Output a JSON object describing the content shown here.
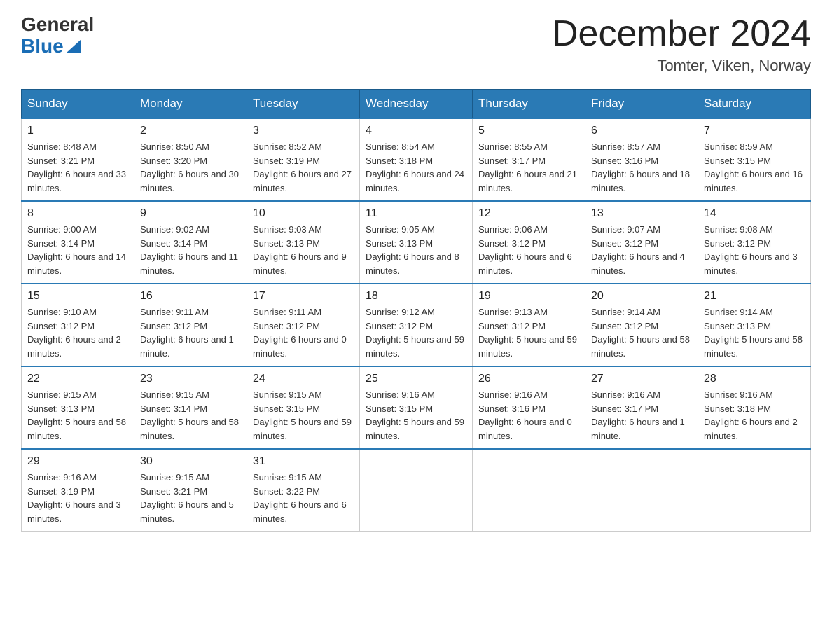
{
  "header": {
    "logo_general": "General",
    "logo_blue": "Blue",
    "month_title": "December 2024",
    "location": "Tomter, Viken, Norway"
  },
  "days_of_week": [
    "Sunday",
    "Monday",
    "Tuesday",
    "Wednesday",
    "Thursday",
    "Friday",
    "Saturday"
  ],
  "weeks": [
    [
      {
        "day": "1",
        "sunrise": "8:48 AM",
        "sunset": "3:21 PM",
        "daylight": "6 hours and 33 minutes."
      },
      {
        "day": "2",
        "sunrise": "8:50 AM",
        "sunset": "3:20 PM",
        "daylight": "6 hours and 30 minutes."
      },
      {
        "day": "3",
        "sunrise": "8:52 AM",
        "sunset": "3:19 PM",
        "daylight": "6 hours and 27 minutes."
      },
      {
        "day": "4",
        "sunrise": "8:54 AM",
        "sunset": "3:18 PM",
        "daylight": "6 hours and 24 minutes."
      },
      {
        "day": "5",
        "sunrise": "8:55 AM",
        "sunset": "3:17 PM",
        "daylight": "6 hours and 21 minutes."
      },
      {
        "day": "6",
        "sunrise": "8:57 AM",
        "sunset": "3:16 PM",
        "daylight": "6 hours and 18 minutes."
      },
      {
        "day": "7",
        "sunrise": "8:59 AM",
        "sunset": "3:15 PM",
        "daylight": "6 hours and 16 minutes."
      }
    ],
    [
      {
        "day": "8",
        "sunrise": "9:00 AM",
        "sunset": "3:14 PM",
        "daylight": "6 hours and 14 minutes."
      },
      {
        "day": "9",
        "sunrise": "9:02 AM",
        "sunset": "3:14 PM",
        "daylight": "6 hours and 11 minutes."
      },
      {
        "day": "10",
        "sunrise": "9:03 AM",
        "sunset": "3:13 PM",
        "daylight": "6 hours and 9 minutes."
      },
      {
        "day": "11",
        "sunrise": "9:05 AM",
        "sunset": "3:13 PM",
        "daylight": "6 hours and 8 minutes."
      },
      {
        "day": "12",
        "sunrise": "9:06 AM",
        "sunset": "3:12 PM",
        "daylight": "6 hours and 6 minutes."
      },
      {
        "day": "13",
        "sunrise": "9:07 AM",
        "sunset": "3:12 PM",
        "daylight": "6 hours and 4 minutes."
      },
      {
        "day": "14",
        "sunrise": "9:08 AM",
        "sunset": "3:12 PM",
        "daylight": "6 hours and 3 minutes."
      }
    ],
    [
      {
        "day": "15",
        "sunrise": "9:10 AM",
        "sunset": "3:12 PM",
        "daylight": "6 hours and 2 minutes."
      },
      {
        "day": "16",
        "sunrise": "9:11 AM",
        "sunset": "3:12 PM",
        "daylight": "6 hours and 1 minute."
      },
      {
        "day": "17",
        "sunrise": "9:11 AM",
        "sunset": "3:12 PM",
        "daylight": "6 hours and 0 minutes."
      },
      {
        "day": "18",
        "sunrise": "9:12 AM",
        "sunset": "3:12 PM",
        "daylight": "5 hours and 59 minutes."
      },
      {
        "day": "19",
        "sunrise": "9:13 AM",
        "sunset": "3:12 PM",
        "daylight": "5 hours and 59 minutes."
      },
      {
        "day": "20",
        "sunrise": "9:14 AM",
        "sunset": "3:12 PM",
        "daylight": "5 hours and 58 minutes."
      },
      {
        "day": "21",
        "sunrise": "9:14 AM",
        "sunset": "3:13 PM",
        "daylight": "5 hours and 58 minutes."
      }
    ],
    [
      {
        "day": "22",
        "sunrise": "9:15 AM",
        "sunset": "3:13 PM",
        "daylight": "5 hours and 58 minutes."
      },
      {
        "day": "23",
        "sunrise": "9:15 AM",
        "sunset": "3:14 PM",
        "daylight": "5 hours and 58 minutes."
      },
      {
        "day": "24",
        "sunrise": "9:15 AM",
        "sunset": "3:15 PM",
        "daylight": "5 hours and 59 minutes."
      },
      {
        "day": "25",
        "sunrise": "9:16 AM",
        "sunset": "3:15 PM",
        "daylight": "5 hours and 59 minutes."
      },
      {
        "day": "26",
        "sunrise": "9:16 AM",
        "sunset": "3:16 PM",
        "daylight": "6 hours and 0 minutes."
      },
      {
        "day": "27",
        "sunrise": "9:16 AM",
        "sunset": "3:17 PM",
        "daylight": "6 hours and 1 minute."
      },
      {
        "day": "28",
        "sunrise": "9:16 AM",
        "sunset": "3:18 PM",
        "daylight": "6 hours and 2 minutes."
      }
    ],
    [
      {
        "day": "29",
        "sunrise": "9:16 AM",
        "sunset": "3:19 PM",
        "daylight": "6 hours and 3 minutes."
      },
      {
        "day": "30",
        "sunrise": "9:15 AM",
        "sunset": "3:21 PM",
        "daylight": "6 hours and 5 minutes."
      },
      {
        "day": "31",
        "sunrise": "9:15 AM",
        "sunset": "3:22 PM",
        "daylight": "6 hours and 6 minutes."
      },
      null,
      null,
      null,
      null
    ]
  ],
  "labels": {
    "sunrise": "Sunrise:",
    "sunset": "Sunset:",
    "daylight": "Daylight:"
  }
}
